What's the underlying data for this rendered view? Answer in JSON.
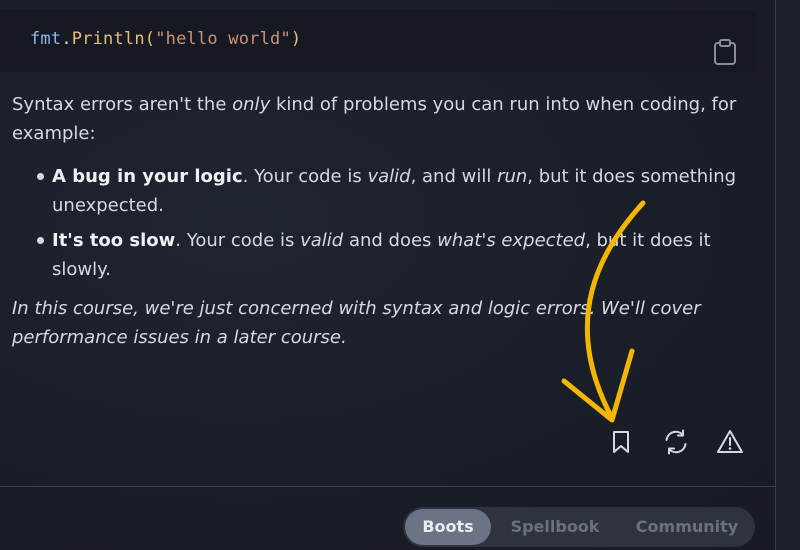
{
  "code": {
    "identifier": "fmt",
    "dot": ".",
    "function": "Println",
    "open_paren": "(",
    "string": "\"hello world\"",
    "close_paren": ")",
    "copy_icon": "clipboard-icon"
  },
  "content": {
    "para1": {
      "before": "Syntax errors aren't the ",
      "emphasis": "only",
      "after": " kind of problems you can run into when coding, for example:"
    },
    "bullets": [
      {
        "bold": "A bug in your logic",
        "t1": ". Your code is ",
        "i1": "valid",
        "t2": ", and will ",
        "i2": "run",
        "t3": ", but it does something unexpected."
      },
      {
        "bold": "It's too slow",
        "t1": ". Your code is ",
        "i1": "valid",
        "t2": " and does ",
        "i2": "what's expected",
        "t3": ", but it does it slowly."
      }
    ],
    "note": "In this course, we're just concerned with syntax and logic errors. We'll cover performance issues in a later course."
  },
  "actions": {
    "bookmark_icon": "bookmark-icon",
    "refresh_icon": "refresh-icon",
    "warning_icon": "warning-icon"
  },
  "tabs": [
    {
      "label": "Boots",
      "active": true
    },
    {
      "label": "Spellbook",
      "active": false
    },
    {
      "label": "Community",
      "active": false
    }
  ],
  "colors": {
    "background": "#1b1f2a",
    "annotation_arrow": "#f2b705",
    "active_tab": "#6b7385"
  }
}
